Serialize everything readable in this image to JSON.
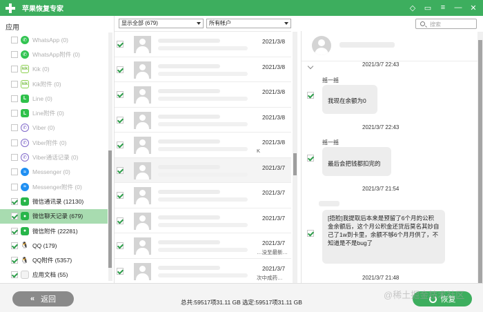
{
  "window": {
    "title": "苹果恢复专家",
    "controls": [
      "diamond-icon",
      "chat-icon",
      "menu-icon",
      "minimize-icon",
      "close-icon"
    ]
  },
  "sidebar": {
    "heading": "应用",
    "items": [
      {
        "label": "WhatsApp (0)",
        "icon": "whatsapp-icon",
        "checked": false,
        "enabled": false
      },
      {
        "label": "WhatsApp附件 (0)",
        "icon": "whatsapp-icon",
        "checked": false,
        "enabled": false
      },
      {
        "label": "Kik (0)",
        "icon": "kik-icon",
        "checked": false,
        "enabled": false
      },
      {
        "label": "Kik附件 (0)",
        "icon": "kik-icon",
        "checked": false,
        "enabled": false
      },
      {
        "label": "Line (0)",
        "icon": "line-icon",
        "checked": false,
        "enabled": false
      },
      {
        "label": "Line附件 (0)",
        "icon": "line-icon",
        "checked": false,
        "enabled": false
      },
      {
        "label": "Viber (0)",
        "icon": "viber-icon",
        "checked": false,
        "enabled": false
      },
      {
        "label": "Viber附件 (0)",
        "icon": "viber-icon",
        "checked": false,
        "enabled": false
      },
      {
        "label": "Viber通话记录 (0)",
        "icon": "viber-icon",
        "checked": false,
        "enabled": false
      },
      {
        "label": "Messenger (0)",
        "icon": "messenger-icon",
        "checked": false,
        "enabled": false
      },
      {
        "label": "Messenger附件 (0)",
        "icon": "messenger-icon",
        "checked": false,
        "enabled": false
      },
      {
        "label": "微信通讯录 (12130)",
        "icon": "wechat-icon",
        "checked": true,
        "enabled": true
      },
      {
        "label": "微信聊天记录 (679)",
        "icon": "wechat-icon",
        "checked": true,
        "enabled": true,
        "active": true
      },
      {
        "label": "微信附件 (22281)",
        "icon": "wechat-icon",
        "checked": true,
        "enabled": true
      },
      {
        "label": "QQ (179)",
        "icon": "qq-icon",
        "checked": true,
        "enabled": true
      },
      {
        "label": "QQ附件 (5357)",
        "icon": "qq-icon",
        "checked": true,
        "enabled": true
      },
      {
        "label": "应用文档 (55)",
        "icon": "document-icon",
        "checked": true,
        "enabled": true
      }
    ]
  },
  "toolbar": {
    "filter_value": "显示全部 (679)",
    "account_value": "所有帐户",
    "search_placeholder": "搜索"
  },
  "conversations": [
    {
      "date": "2021/3/8",
      "snippet": "",
      "checked": true
    },
    {
      "date": "2021/3/8",
      "snippet": "",
      "checked": true
    },
    {
      "date": "2021/3/8",
      "snippet": "",
      "checked": true
    },
    {
      "date": "2021/3/8",
      "snippet": "",
      "checked": true
    },
    {
      "date": "2021/3/8",
      "snippet": "K",
      "checked": true
    },
    {
      "date": "2021/3/7",
      "snippet": "",
      "checked": true,
      "active": true
    },
    {
      "date": "2021/3/7",
      "snippet": "",
      "checked": true
    },
    {
      "date": "2021/3/7",
      "snippet": "",
      "checked": true
    },
    {
      "date": "2021/3/7",
      "snippet": "…没至最新…",
      "checked": true
    },
    {
      "date": "2021/3/7",
      "snippet": "次中成药…",
      "checked": true
    }
  ],
  "chat": {
    "messages": [
      {
        "time": "2021/3/7 22:43",
        "sender": "摇一摇",
        "text": "我现在余额为0",
        "checked": true
      },
      {
        "time": "2021/3/7 22:43",
        "sender": "摇一摇",
        "text": "最后会把钱都扣完的",
        "checked": true
      },
      {
        "time": "2021/3/7 21:54",
        "sender": "",
        "text": "[捂脸]我提取后本来是预留了6个月的公积金余额后，这个月公积金还贷后莫名其妙自己了1w到卡里，余额不够6个月月供了，不知道是不是bug了",
        "checked": true
      },
      {
        "time": "2021/3/7 21:48",
        "sender": "",
        "text": "",
        "checked": false
      }
    ]
  },
  "footer": {
    "back_label": "返回",
    "status": "总共:59517项31.11 GB 选定:59517项31.11 GB",
    "recover_label": "恢复",
    "watermark": "@稀土掘金技术社区"
  },
  "colors": {
    "brand_green": "#3dae5e",
    "active_row": "#a8dcb0",
    "back_button": "#8a8a8a"
  }
}
